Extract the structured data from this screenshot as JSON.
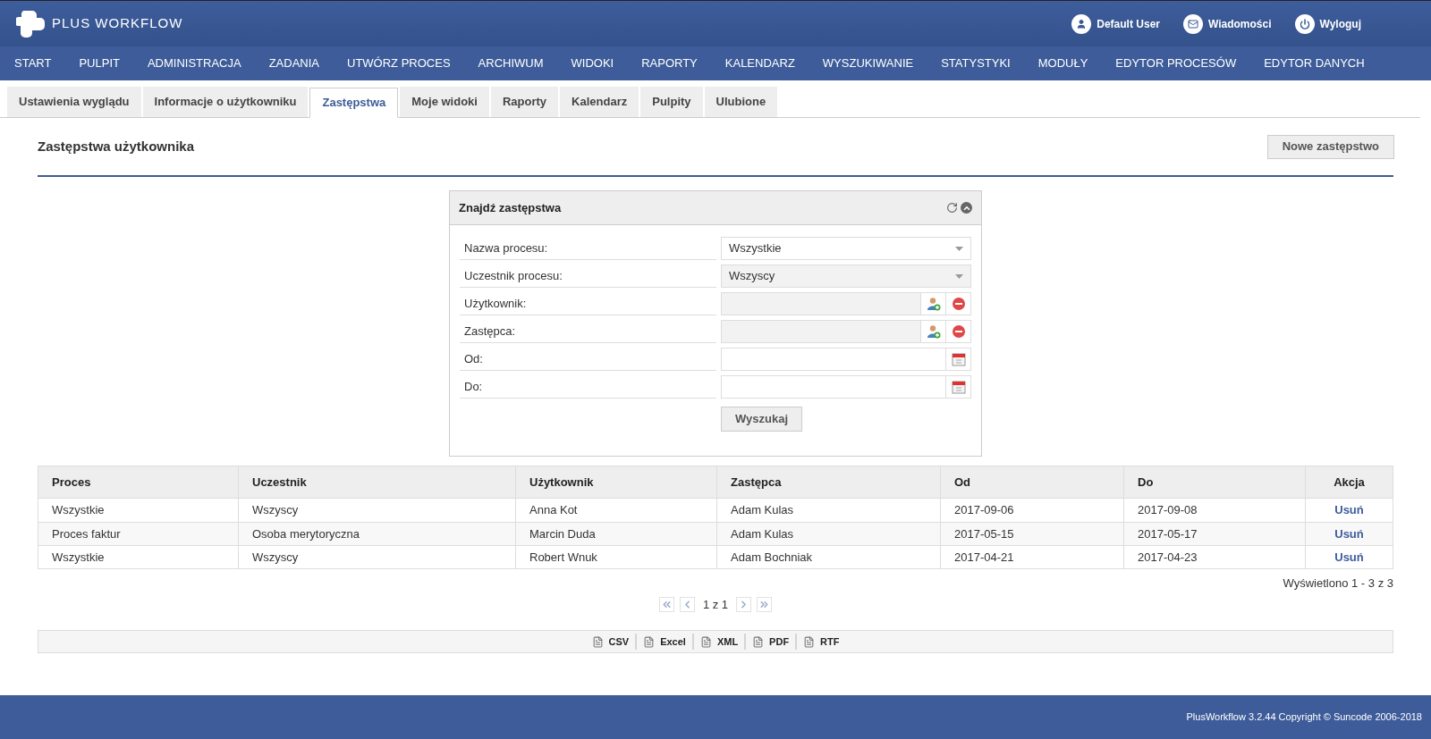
{
  "header": {
    "logo": {
      "text_1": "PLUS",
      "text_2": "WORKFLOW"
    },
    "links": [
      {
        "kind": "user",
        "label": "Default User"
      },
      {
        "kind": "mail",
        "label": "Wiadomości"
      },
      {
        "kind": "power",
        "label": "Wyloguj"
      }
    ]
  },
  "nav": [
    "START",
    "PULPIT",
    "ADMINISTRACJA",
    "ZADANIA",
    "UTWÓRZ PROCES",
    "ARCHIWUM",
    "WIDOKI",
    "RAPORTY",
    "KALENDARZ",
    "WYSZUKIWANIE",
    "STATYSTYKI",
    "MODUŁY",
    "EDYTOR PROCESÓW",
    "EDYTOR DANYCH"
  ],
  "tabs": [
    {
      "label": "Ustawienia wyglądu",
      "selected": false
    },
    {
      "label": "Informacje o użytkowniku",
      "selected": false
    },
    {
      "label": "Zastępstwa",
      "selected": true
    },
    {
      "label": "Moje widoki",
      "selected": false
    },
    {
      "label": "Raporty",
      "selected": false
    },
    {
      "label": "Kalendarz",
      "selected": false
    },
    {
      "label": "Pulpity",
      "selected": false
    },
    {
      "label": "Ulubione",
      "selected": false
    }
  ],
  "page": {
    "title": "Zastępstwa użytkownika",
    "new_button": "Nowe zastępstwo"
  },
  "search_panel": {
    "title": "Znajdź zastępstwa",
    "fields": [
      {
        "label": "Nazwa procesu:",
        "kind": "select",
        "value": "Wszystkie",
        "disabled": false
      },
      {
        "label": "Uczestnik procesu:",
        "kind": "select",
        "value": "Wszyscy",
        "disabled": true
      },
      {
        "label": "Użytkownik:",
        "kind": "user",
        "disabled": true
      },
      {
        "label": "Zastępca:",
        "kind": "user",
        "disabled": true
      },
      {
        "label": "Od:",
        "kind": "date",
        "disabled": false
      },
      {
        "label": "Do:",
        "kind": "date",
        "disabled": false
      }
    ],
    "search_button": "Wyszukaj"
  },
  "table": {
    "columns": [
      "Proces",
      "Uczestnik",
      "Użytkownik",
      "Zastępca",
      "Od",
      "Do",
      "Akcja"
    ],
    "rows": [
      [
        "Wszystkie",
        "Wszyscy",
        "Anna Kot",
        "Adam Kulas",
        "2017-09-06",
        "2017-09-08",
        "Usuń"
      ],
      [
        "Proces faktur",
        "Osoba merytoryczna",
        "Marcin Duda",
        "Adam Kulas",
        "2017-05-15",
        "2017-05-17",
        "Usuń"
      ],
      [
        "Wszystkie",
        "Wszyscy",
        "Robert Wnuk",
        "Adam Bochniak",
        "2017-04-21",
        "2017-04-23",
        "Usuń"
      ]
    ],
    "summary": "Wyświetlono 1 - 3 z 3"
  },
  "pager": {
    "text": "1 z 1"
  },
  "export": [
    "CSV",
    "Excel",
    "XML",
    "PDF",
    "RTF"
  ],
  "footer": "PlusWorkflow 3.2.44 Copyright © Suncode 2006-2018"
}
